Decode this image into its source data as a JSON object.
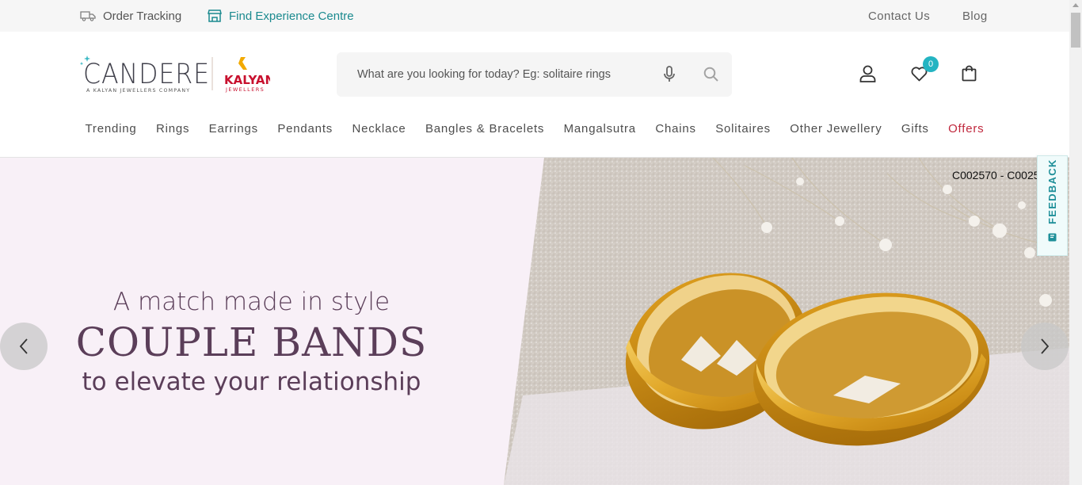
{
  "topbar": {
    "order_tracking": "Order Tracking",
    "find_centre": "Find Experience Centre",
    "contact": "Contact Us",
    "blog": "Blog"
  },
  "logo": {
    "brand": "CANDERE",
    "tagline": "A KALYAN JEWELLERS COMPANY",
    "partner": "KALYAN",
    "partner_sub": "JEWELLERS"
  },
  "search": {
    "placeholder": "What are you looking for today? Eg: solitaire rings"
  },
  "header": {
    "wishlist_count": "0"
  },
  "nav": {
    "items": [
      "Trending",
      "Rings",
      "Earrings",
      "Pendants",
      "Necklace",
      "Bangles & Bracelets",
      "Mangalsutra",
      "Chains",
      "Solitaires",
      "Other Jewellery",
      "Gifts",
      "Offers"
    ]
  },
  "hero": {
    "line1": "A match made in style",
    "line2": "COUPLE BANDS",
    "line3": "to elevate your relationship",
    "code": "C002570 - C0025"
  },
  "feedback": {
    "label": "FEEDBACK"
  },
  "colors": {
    "accent": "#24b4c2",
    "teal_link": "#1b8a8f",
    "offers": "#c0283d",
    "hero_bg": "#f8f0f7",
    "hero_text": "#5b3e59"
  }
}
